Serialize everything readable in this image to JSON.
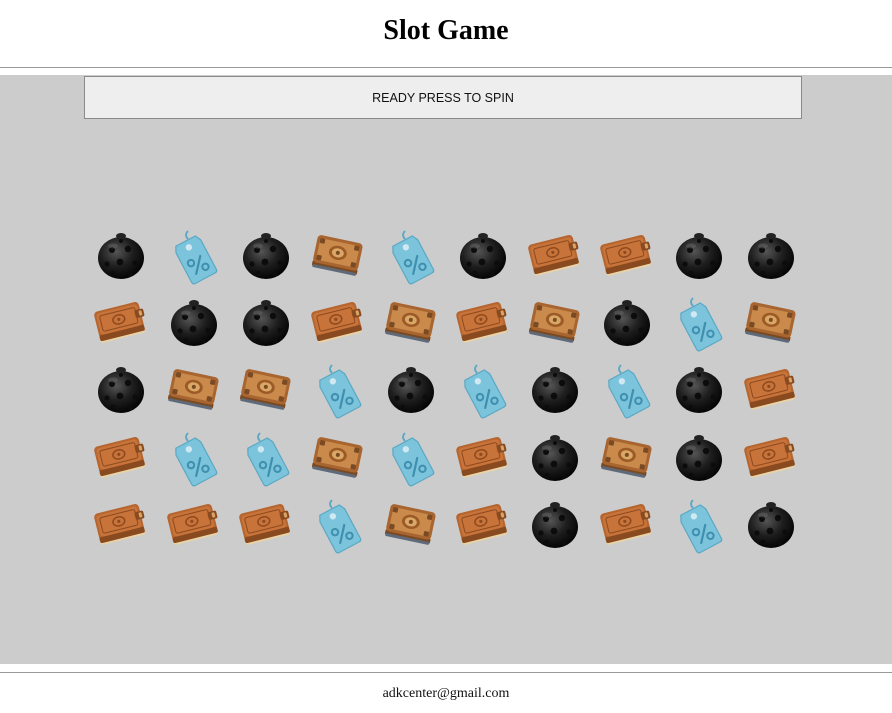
{
  "header": {
    "title": "Slot Game"
  },
  "status": {
    "label": "READY PRESS TO SPIN"
  },
  "footer": {
    "email": "adkcenter@gmail.com"
  },
  "symbols": {
    "bomb": "bomb-icon",
    "tag": "percent-tag-icon",
    "book": "leather-book-icon",
    "ornate": "ornate-book-icon"
  },
  "grid": [
    [
      "bomb",
      "tag",
      "bomb",
      "ornate",
      "tag",
      "bomb",
      "book",
      "book",
      "bomb",
      "bomb"
    ],
    [
      "book",
      "bomb",
      "bomb",
      "book",
      "ornate",
      "book",
      "ornate",
      "bomb",
      "tag",
      "ornate"
    ],
    [
      "bomb",
      "ornate",
      "ornate",
      "tag",
      "bomb",
      "tag",
      "bomb",
      "tag",
      "bomb",
      "book"
    ],
    [
      "book",
      "tag",
      "tag",
      "ornate",
      "tag",
      "book",
      "bomb",
      "ornate",
      "bomb",
      "book"
    ],
    [
      "book",
      "book",
      "book",
      "tag",
      "ornate",
      "book",
      "bomb",
      "book",
      "tag",
      "bomb"
    ]
  ]
}
